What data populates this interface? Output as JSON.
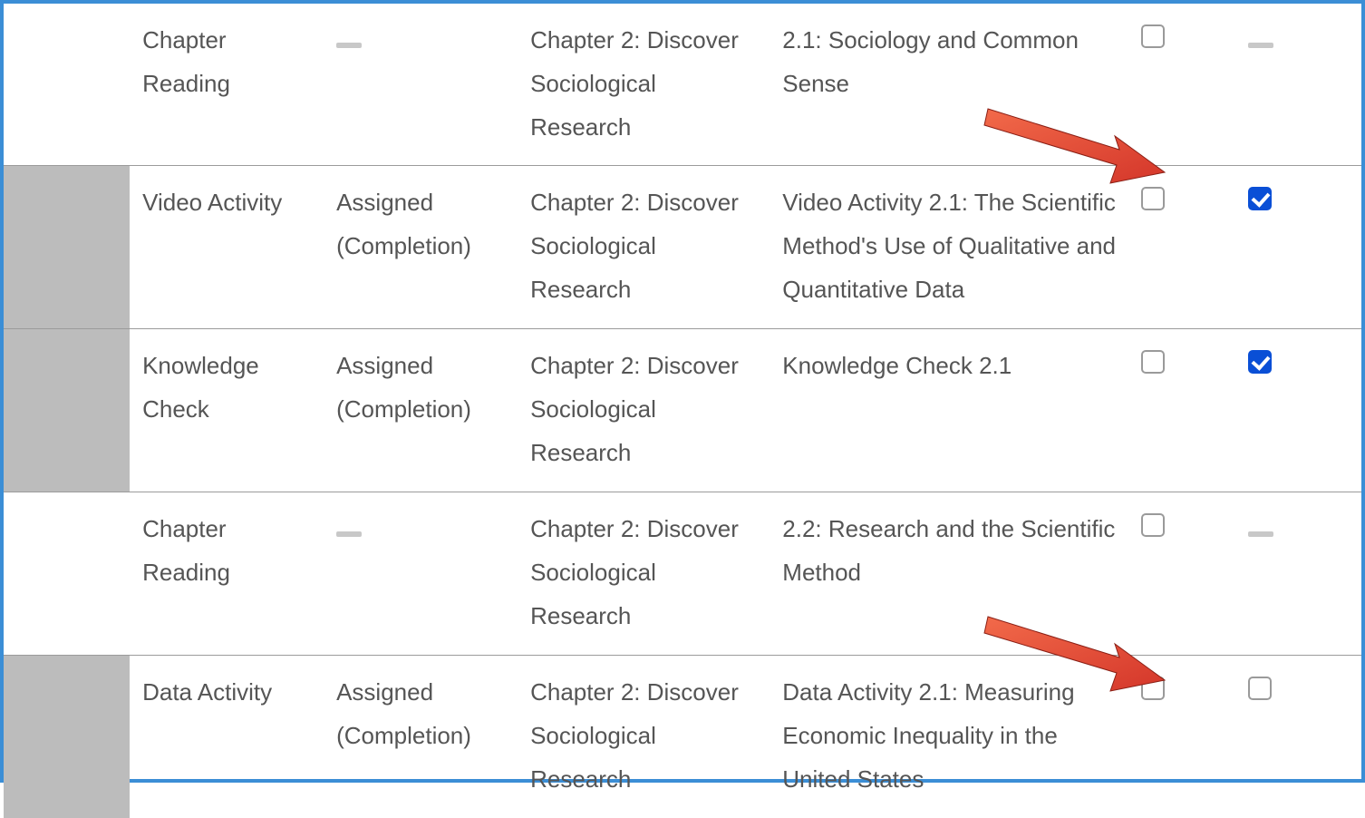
{
  "rows": [
    {
      "marker": false,
      "type": "Chapter Reading",
      "status_kind": "dash",
      "status": "",
      "chapter": "Chapter 2: Discover Sociological Research",
      "title": "2.1: Sociology and Common Sense",
      "chk1": false,
      "chk2_kind": "dash",
      "chk2": false
    },
    {
      "marker": true,
      "type": "Video Activity",
      "status_kind": "text",
      "status": "Assigned (Completion)",
      "chapter": "Chapter 2: Discover Sociological Research",
      "title": "Video Activity 2.1: The Scientific Method's Use of Qualitative and Quantitative Data",
      "chk1": false,
      "chk2_kind": "checkbox",
      "chk2": true
    },
    {
      "marker": true,
      "type": "Knowledge Check",
      "status_kind": "text",
      "status": "Assigned (Completion)",
      "chapter": "Chapter 2: Discover Sociological Research",
      "title": "Knowledge Check 2.1",
      "chk1": false,
      "chk2_kind": "checkbox",
      "chk2": true
    },
    {
      "marker": false,
      "type": "Chapter Reading",
      "status_kind": "dash",
      "status": "",
      "chapter": "Chapter 2: Discover Sociological Research",
      "title": "2.2: Research and the Scientific Method",
      "chk1": false,
      "chk2_kind": "dash",
      "chk2": false
    },
    {
      "marker": true,
      "type": "Data Activity",
      "status_kind": "text",
      "status": "Assigned (Completion)",
      "chapter": "Chapter 2: Discover Sociological Research",
      "title": "Data Activity 2.1: Measuring Economic Inequality in the United States",
      "chk1": false,
      "chk2_kind": "checkbox",
      "chk2": false
    }
  ],
  "annotations": {
    "arrow1_target": "row-1-checkbox-2",
    "arrow2_target": "row-4-checkbox-2"
  }
}
